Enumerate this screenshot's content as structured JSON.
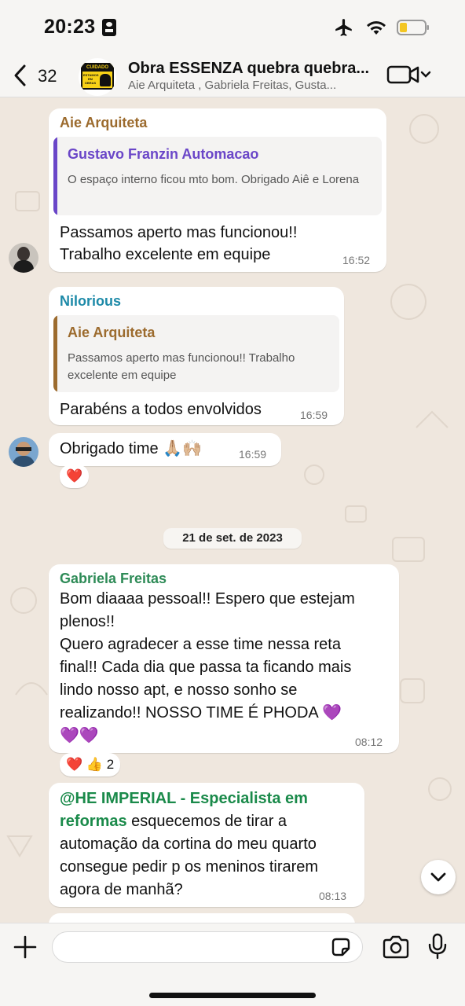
{
  "status_bar": {
    "time": "20:23"
  },
  "header": {
    "back_count": "32",
    "title": "Obra ESSENZA quebra quebra...",
    "subtitle": "Aie Arquiteta , Gabriela Freitas, Gusta...",
    "avatar_sign": {
      "top": "CUIDADO",
      "text": "ESTAMOS EM OBRAS"
    }
  },
  "messages": [
    {
      "sender": "Aie Arquiteta",
      "sender_color": "#9c6b2e",
      "quote_name": "Gustavo Franzin Automacao",
      "quote_color": "#6a46c8",
      "quote_text": "O espaço interno ficou mto bom. Obrigado Aiê e Lorena",
      "text_line1": "Passamos aperto mas funcionou!!",
      "text_line2": "Trabalho excelente em equipe",
      "time": "16:52"
    },
    {
      "sender": "Nilorious",
      "sender_color": "#1d8aa8",
      "quote_name": "Aie Arquiteta",
      "quote_color": "#9c6b2e",
      "quote_text": "Passamos aperto mas funcionou!! Trabalho excelente em equipe",
      "text": "Parabéns a todos envolvidos",
      "time": "16:59"
    },
    {
      "text": "Obrigado time 🙏🏼🙌🏼",
      "time": "16:59",
      "reaction": "❤️"
    },
    {
      "sender": "Gabriela Freitas",
      "sender_color": "#2e8b57",
      "lines": [
        "Bom diaaaa pessoal!! Espero que estejam",
        "plenos!!",
        "Quero agradecer a esse time nessa reta",
        "final!! Cada dia que passa ta ficando mais",
        "lindo nosso apt, e nosso sonho se",
        "realizando!!  NOSSO TIME É PHODA 💜",
        "💜💜"
      ],
      "time": "08:12",
      "reaction": "❤️ 👍 2"
    },
    {
      "mention_line1": "@HE IMPERIAL - Especialista em",
      "mention_line2": "reformas",
      "text_line2": " esquecemos de tirar a",
      "lines": [
        "automação da cortina do meu quarto",
        "consegue pedir p os meninos tirarem",
        "agora de manhã?"
      ],
      "time": "08:13"
    }
  ],
  "date_divider": "21 de set. de 2023",
  "composer": {
    "placeholder": ""
  }
}
